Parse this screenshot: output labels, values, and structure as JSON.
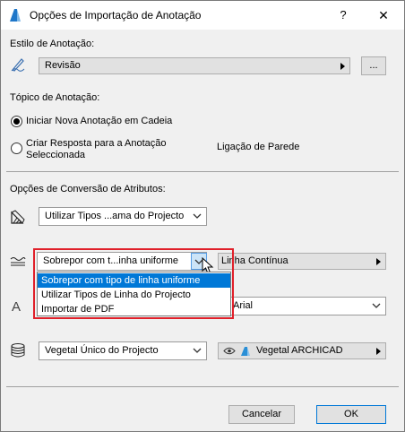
{
  "window": {
    "title": "Opções de Importação de Anotação",
    "help": "?",
    "close": "✕"
  },
  "style_section": {
    "label": "Estilo de Anotação:",
    "value": "Revisão",
    "browse": "..."
  },
  "topic_section": {
    "label": "Tópico de Anotação:",
    "option1": "Iniciar Nova Anotação em Cadeia",
    "option2_line1": "Criar Resposta para a Anotação",
    "option2_line2": "Seleccionada",
    "link_label": "Ligação de Parede"
  },
  "conversion_section": {
    "label": "Opções de Conversão de Atributos:",
    "pen_select": "Utilizar Tipos ...ama do Projecto",
    "linetype_select": "Sobrepor com t...inha uniforme",
    "linetype_value": "Linha Contínua",
    "font_value": "Arial",
    "fill_select": "Vegetal Único do Projecto",
    "fill_value": "Vegetal ARCHICAD"
  },
  "dropdown": {
    "items": [
      "Sobrepor com tipo de linha uniforme",
      "Utilizar Tipos de Linha do Projecto",
      "Importar de PDF"
    ]
  },
  "footer": {
    "cancel": "Cancelar",
    "ok": "OK"
  },
  "colors": {
    "accent": "#0078d7",
    "highlight": "#e0202a",
    "archicad_blue": "#2a8fd6"
  }
}
